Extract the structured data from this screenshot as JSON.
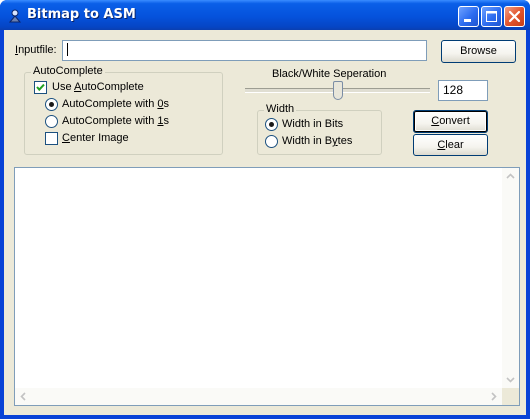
{
  "window": {
    "title": "Bitmap to ASM",
    "icon": "app-icon",
    "controls": [
      "minimize-icon",
      "maximize-icon",
      "close-icon"
    ]
  },
  "input": {
    "label_before": "",
    "label_accel": "I",
    "label_after": "nputfile:",
    "value": "",
    "browse_label": "Browse"
  },
  "autocomplete": {
    "title": "AutoComplete",
    "use": {
      "before": "Use ",
      "accel": "A",
      "after": "utoComplete",
      "checked": true
    },
    "with0": {
      "before": "AutoComplete with ",
      "accel": "0",
      "after": "s",
      "selected": true
    },
    "with1": {
      "before": "AutoComplete with ",
      "accel": "1",
      "after": "s",
      "selected": false
    },
    "center": {
      "before": "",
      "accel": "C",
      "after": "enter Image",
      "checked": false
    }
  },
  "separation": {
    "label": "Black/White Seperation",
    "value": "128",
    "level_fraction": 0.5
  },
  "width": {
    "title": "Width",
    "bits": {
      "before": "Width in Bits",
      "selected": true
    },
    "bytes": {
      "before": "Width in B",
      "accel": "y",
      "after": "tes",
      "selected": false
    }
  },
  "actions": {
    "convert_accel": "C",
    "convert_rest": "onvert",
    "clear_accel": "C",
    "clear_rest": "lear"
  },
  "output": {
    "text": ""
  },
  "colors": {
    "titlebar": "#0552dc",
    "face": "#ece9d8",
    "border": "#7f9db9"
  }
}
